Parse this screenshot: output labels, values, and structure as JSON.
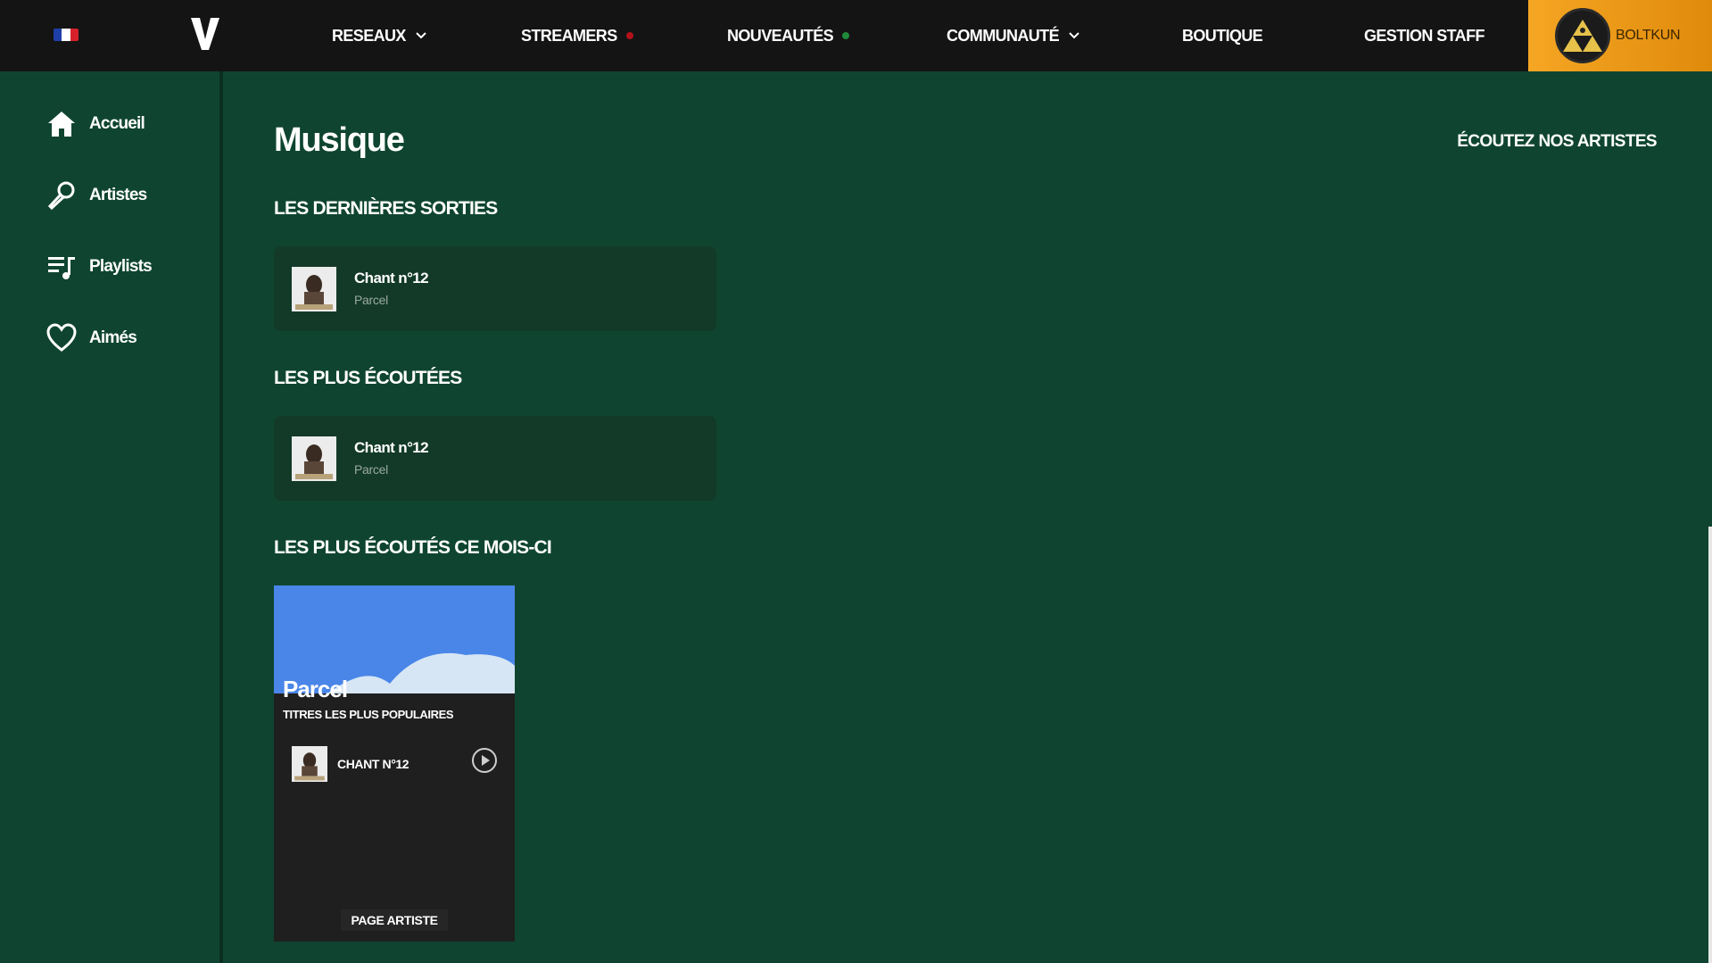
{
  "nav": {
    "items": [
      {
        "label": "RESEAUX",
        "chevron": true
      },
      {
        "label": "STREAMERS",
        "dot_color": "#b3121b"
      },
      {
        "label": "NOUVEAUTÉS",
        "dot_color": "#1f8a3a"
      },
      {
        "label": "COMMUNAUTÉ",
        "chevron": true
      },
      {
        "label": "BOUTIQUE"
      },
      {
        "label": "GESTION STAFF"
      }
    ],
    "user": {
      "name": "BOLTKUN"
    },
    "colors": {
      "accent": "#f5a623",
      "bar": "#141414"
    }
  },
  "sidebar": {
    "items": [
      {
        "label": "Accueil",
        "icon": "home-icon"
      },
      {
        "label": "Artistes",
        "icon": "microphone-icon"
      },
      {
        "label": "Playlists",
        "icon": "playlist-icon"
      },
      {
        "label": "Aimés",
        "icon": "heart-icon"
      }
    ]
  },
  "main": {
    "title": "Musique",
    "listen_link": "ÉCOUTEZ NOS ARTISTES",
    "sections": [
      {
        "title": "LES DERNIÈRES SORTIES",
        "track": {
          "title": "Chant n°12",
          "artist": "Parcel"
        }
      },
      {
        "title": "LES PLUS ÉCOUTÉES",
        "track": {
          "title": "Chant n°12",
          "artist": "Parcel"
        }
      },
      {
        "title": "LES PLUS ÉCOUTÉS CE MOIS-CI"
      }
    ],
    "artist_card": {
      "name": "Parcel",
      "popular_label": "TITRES LES PLUS POPULAIRES",
      "track": "CHANT N°12",
      "page_button": "PAGE ARTISTE"
    }
  }
}
